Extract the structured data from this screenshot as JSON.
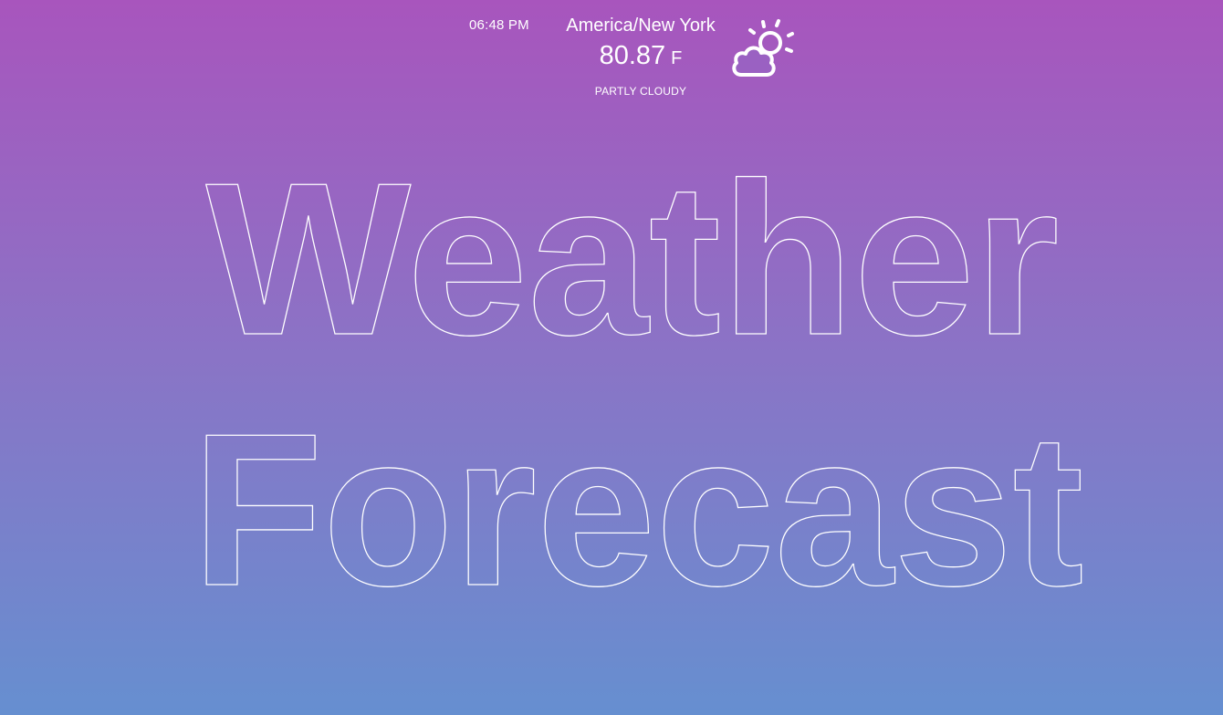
{
  "header": {
    "time": "06:48 PM",
    "location": "America/New York",
    "temperature": "80.87",
    "unit": "F",
    "summary": "PARTLY CLOUDY",
    "icon": "partly-cloudy-icon"
  },
  "headline": {
    "line1": "Weather",
    "line2": "Forecast"
  }
}
